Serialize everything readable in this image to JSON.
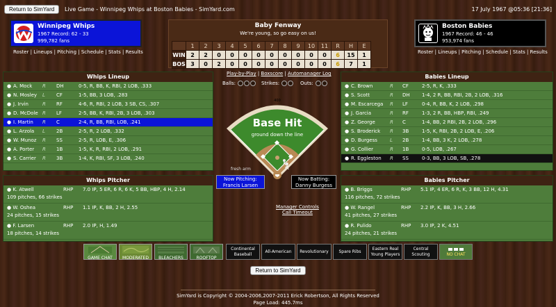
{
  "header": {
    "return_label": "Return to SimYard",
    "game_title": "Live Game - Winnipeg Whips at Boston Babies - SimYard.com",
    "datetime": "17 July 1967 @05:36 [21:36]"
  },
  "away_team": {
    "name": "Winnipeg Whips",
    "record": "1967 Record: 62 - 33",
    "fans": "999,782 fans",
    "links": [
      "Roster",
      "Lineups",
      "Pitching",
      "Schedule",
      "Stats",
      "Results"
    ],
    "color": "#0b14d8"
  },
  "home_team": {
    "name": "Boston Babies",
    "record": "1967 Record: 46 - 46",
    "fans": "953,974 fans",
    "links": [
      "Roster",
      "Lineups",
      "Pitching",
      "Schedule",
      "Stats",
      "Results"
    ],
    "color": "#000000"
  },
  "scoreboard": {
    "park": "Baby Fenway",
    "slogan": "We're young, so go easy on us!",
    "headers": [
      "",
      "1",
      "2",
      "3",
      "4",
      "5",
      "6",
      "7",
      "8",
      "9",
      "10",
      "11",
      "R",
      "H",
      "E"
    ],
    "rows": [
      {
        "team": "WIN",
        "cells": [
          "2",
          "2",
          "0",
          "0",
          "0",
          "0",
          "0",
          "0",
          "0",
          "0",
          "0"
        ],
        "r": "6",
        "h": "15",
        "e": "1"
      },
      {
        "team": "BOS",
        "cells": [
          "3",
          "0",
          "2",
          "0",
          "0",
          "0",
          "0",
          "0",
          "0",
          "0",
          "0"
        ],
        "r": "6",
        "h": "7",
        "e": "1"
      }
    ]
  },
  "away_lineup": {
    "title": "Whips Lineup",
    "rows": [
      {
        "name": "A. Mock",
        "hand": "R",
        "pos": "DH",
        "stats": "0-5, R, BB, K, RBI, 2 LOB, .333"
      },
      {
        "name": "N. Mosley",
        "hand": "L",
        "pos": "CF",
        "stats": "1-5, BB, 3 LOB, .283"
      },
      {
        "name": "J. Irvin",
        "hand": "R",
        "pos": "RF",
        "stats": "4-6, R, RBI, 2 LOB, 3 SB, CS, .307"
      },
      {
        "name": "D. McDole",
        "hand": "R",
        "pos": "LF",
        "stats": "2-5, BB, K, RBI, 2B, 3 LOB, .303"
      },
      {
        "name": "I. Martin",
        "hand": "R",
        "pos": "C",
        "stats": "2-4, R, BB, RBI, LOB, .241"
      },
      {
        "name": "L. Arzola",
        "hand": "L",
        "pos": "2B",
        "stats": "2-5, R, 2 LOB, .332"
      },
      {
        "name": "W. Munoz",
        "hand": "R",
        "pos": "SS",
        "stats": "2-5, R, LOB, E, .306"
      },
      {
        "name": "A. Porter",
        "hand": "R",
        "pos": "1B",
        "stats": "1-5, K, R, RBI, 2 LOB, .291"
      },
      {
        "name": "S. Carrier",
        "hand": "R",
        "pos": "3B",
        "stats": "1-4, K, RBI, SF, 3 LOB, .240"
      }
    ]
  },
  "home_lineup": {
    "title": "Babies Lineup",
    "rows": [
      {
        "name": "C. Brown",
        "hand": "R",
        "pos": "CF",
        "stats": "2-5, R, K, .333"
      },
      {
        "name": "S. Scott",
        "hand": "R",
        "pos": "DH",
        "stats": "1-4, 2 R, BB, RBI, 2B, 2 LOB, .316"
      },
      {
        "name": "M. Escarcega",
        "hand": "R",
        "pos": "LF",
        "stats": "0-4, R, BB, K, 2 LOB, .298"
      },
      {
        "name": "J. Garcia",
        "hand": "R",
        "pos": "RF",
        "stats": "1-3, 2 R, BB, HBP, RBI, .249"
      },
      {
        "name": "Z. George",
        "hand": "R",
        "pos": "C",
        "stats": "1-4, BB, 2 RBI, 2B, 2 LOB, .296"
      },
      {
        "name": "S. Broderick",
        "hand": "R",
        "pos": "3B",
        "stats": "1-5, K, RBI, 2B, 2 LOB, E, .206"
      },
      {
        "name": "D. Burgess",
        "hand": "L",
        "pos": "2B",
        "stats": "1-4, BB, 3 K, 2 LOB, .278"
      },
      {
        "name": "G. Collier",
        "hand": "R",
        "pos": "1B",
        "stats": "0-5, LOB, .267"
      },
      {
        "name": "R. Eggleston",
        "hand": "R",
        "pos": "SS",
        "stats": "0-3, BB, 3 LOB, SB, .278"
      }
    ]
  },
  "away_pitchers": {
    "title": "Whips Pitcher",
    "rows": [
      {
        "name": "K. Atwell",
        "throws": "RHP",
        "line": "7.0 IP, 5 ER, 6 R, 6 K, 5 BB, HBP, 4 H, 2.14",
        "pitches": "109 pitches, 66 strikes"
      },
      {
        "name": "W. Oshea",
        "throws": "RHP",
        "line": "1.1 IP, K, BB, 2 H, 2.55",
        "pitches": "24 pitches, 15 strikes"
      },
      {
        "name": "F. Larsen",
        "throws": "RHP",
        "line": "2.0 IP, H, 1.49",
        "pitches": "18 pitches, 14 strikes"
      }
    ]
  },
  "home_pitchers": {
    "title": "Babies Pitcher",
    "rows": [
      {
        "name": "B. Briggs",
        "throws": "RHP",
        "line": "5.1 IP, 4 ER, 6 R, K, 3 BB, 12 H, 4.31",
        "pitches": "116 pitches, 72 strikes"
      },
      {
        "name": "W. Rangel",
        "throws": "RHP",
        "line": "2.2 IP, K, BB, 3 H, 2.66",
        "pitches": "41 pitches, 27 strikes"
      },
      {
        "name": "R. Pulido",
        "throws": "RHP",
        "line": "3.0 IP, 2 K, 4.51",
        "pitches": "24 pitches, 21 strikes"
      }
    ]
  },
  "center": {
    "links": [
      "Play-by-Play",
      "Boxscore",
      "Automanager Log"
    ],
    "balls_label": "Balls:",
    "strikes_label": "Strikes:",
    "outs_label": "Outs:",
    "play_result": "Base Hit",
    "play_detail": "ground down the line",
    "fence_label": "400",
    "fresh_arm": "fresh arm",
    "now_pitching_label": "Now Pitching:",
    "now_pitching": "Francis Larsen",
    "now_batting_label": "Now Batting:",
    "now_batting": "Danny Burgess",
    "manager_controls": "Manager Controls",
    "call_timeout": "Call Timeout"
  },
  "chat_options": [
    {
      "label": "GAME CHAT"
    },
    {
      "label": "MODERATED"
    },
    {
      "label": "BLEACHERS"
    },
    {
      "label": "ROOFTOP"
    }
  ],
  "ui_options": [
    {
      "label": "Continental Baseball"
    },
    {
      "label": "All-American"
    },
    {
      "label": "Revolutionary"
    },
    {
      "label": "Spare Ribs"
    },
    {
      "label": "Eastern Real Young Players"
    },
    {
      "label": "Central Scouting"
    },
    {
      "label": "NO CHAT"
    }
  ],
  "footer": {
    "return_label": "Return to SimYard",
    "copyright": "SimYard is Copyright © 2004-2006,2007-2011 Erick Robertson, All Rights Reserved",
    "page_load": "Page Load: 445.7ms"
  }
}
